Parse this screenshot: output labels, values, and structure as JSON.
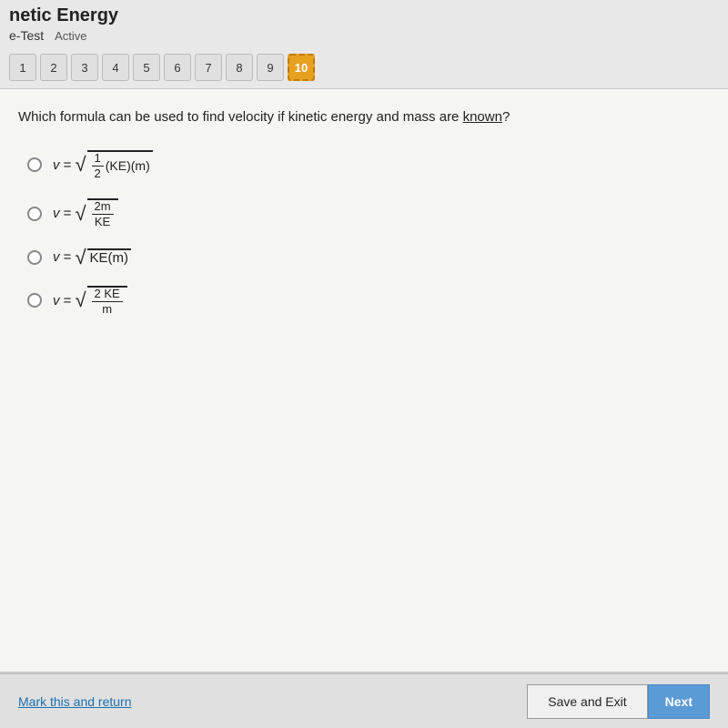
{
  "header": {
    "title": "netic Energy",
    "mode_label": "e-Test",
    "status": "Active"
  },
  "question_nav": {
    "items": [
      {
        "label": "1",
        "active": false
      },
      {
        "label": "2",
        "active": false
      },
      {
        "label": "3",
        "active": false
      },
      {
        "label": "4",
        "active": false
      },
      {
        "label": "5",
        "active": false
      },
      {
        "label": "6",
        "active": false
      },
      {
        "label": "7",
        "active": false
      },
      {
        "label": "8",
        "active": false
      },
      {
        "label": "9",
        "active": false
      },
      {
        "label": "10",
        "active": true
      }
    ]
  },
  "question": {
    "text": "Which formula can be used to find velocity if kinetic energy and mass are known?",
    "options": [
      {
        "id": "a",
        "label": "v = √( ½ (KE)(m) )"
      },
      {
        "id": "b",
        "label": "v = √( 2m / KE )"
      },
      {
        "id": "c",
        "label": "v = √KE(m)"
      },
      {
        "id": "d",
        "label": "v = √( 2KE / m )"
      }
    ]
  },
  "footer": {
    "mark_return_label": "Mark this and return",
    "save_exit_label": "Save and Exit",
    "next_label": "Next"
  }
}
